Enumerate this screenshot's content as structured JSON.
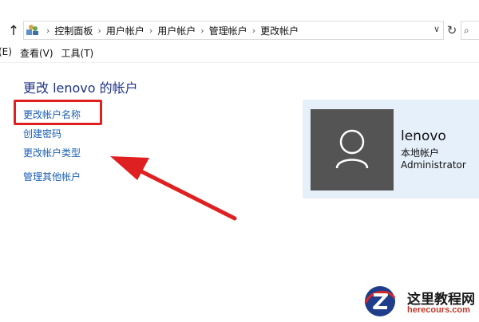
{
  "address_bar": {
    "breadcrumbs": [
      "控制面板",
      "用户帐户",
      "用户帐户",
      "管理帐户",
      "更改帐户"
    ]
  },
  "menu": {
    "edit": "(E)",
    "view": "查看(V)",
    "tools": "工具(T)"
  },
  "main": {
    "title": "更改 lenovo 的帐户",
    "tasks": [
      "更改帐户名称",
      "创建密码",
      "更改帐户类型",
      "管理其他帐户"
    ]
  },
  "user": {
    "name": "lenovo",
    "type": "本地帐户",
    "group": "Administrator"
  },
  "annotation": {
    "highlight_color": "#e02020",
    "arrow_color": "#e02020"
  },
  "watermark": {
    "name": "这里教程网",
    "site": "herecours.com"
  }
}
